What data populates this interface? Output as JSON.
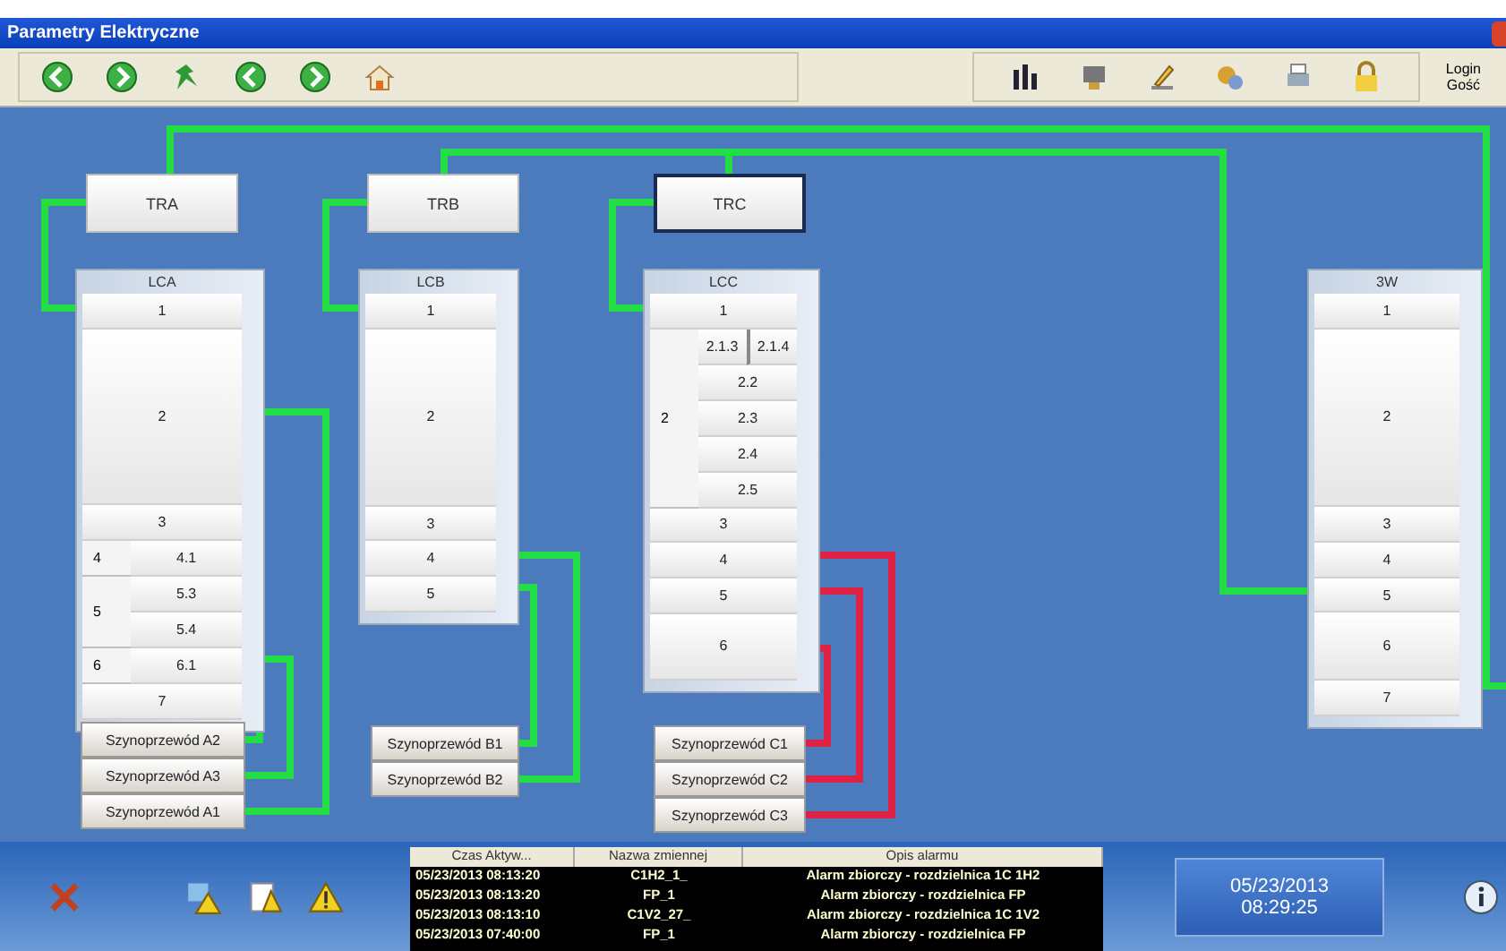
{
  "window": {
    "title": "Parametry Elektryczne"
  },
  "toolbar": {
    "user_label": "Login",
    "user_name": "Gość"
  },
  "transformers": [
    {
      "label": "TRA",
      "selected": false
    },
    {
      "label": "TRB",
      "selected": false
    },
    {
      "label": "TRC",
      "selected": true
    }
  ],
  "panels": [
    {
      "title": "LCA",
      "rows": [
        {
          "kind": "row",
          "label": "1"
        },
        {
          "kind": "tall",
          "label": "2"
        },
        {
          "kind": "row",
          "label": "3"
        },
        {
          "kind": "group",
          "label": "4",
          "children": [
            {
              "kind": "row",
              "label": "4.1"
            }
          ]
        },
        {
          "kind": "group",
          "label": "5",
          "children": [
            {
              "kind": "row",
              "label": "5.3"
            },
            {
              "kind": "row",
              "label": "5.4"
            }
          ]
        },
        {
          "kind": "group",
          "label": "6",
          "children": [
            {
              "kind": "row",
              "label": "6.1"
            }
          ]
        },
        {
          "kind": "row",
          "label": "7"
        }
      ],
      "busbars": [
        {
          "label": "Szynoprzewód A2",
          "color": "#22dd44"
        },
        {
          "label": "Szynoprzewód A3",
          "color": "#22dd44"
        },
        {
          "label": "Szynoprzewód A1",
          "color": "#22dd44"
        }
      ]
    },
    {
      "title": "LCB",
      "rows": [
        {
          "kind": "row",
          "label": "1"
        },
        {
          "kind": "tall",
          "label": "2"
        },
        {
          "kind": "row",
          "label": "3"
        },
        {
          "kind": "row",
          "label": "4"
        },
        {
          "kind": "row",
          "label": "5"
        }
      ],
      "busbars": [
        {
          "label": "Szynoprzewód B1",
          "color": "#22dd44"
        },
        {
          "label": "Szynoprzewód B2",
          "color": "#22dd44"
        }
      ]
    },
    {
      "title": "LCC",
      "rows": [
        {
          "kind": "row",
          "label": "1"
        },
        {
          "kind": "group",
          "label": "2",
          "children": [
            {
              "kind": "split",
              "labels": [
                "2.1.3",
                "2.1.4"
              ]
            },
            {
              "kind": "row",
              "label": "2.2"
            },
            {
              "kind": "row",
              "label": "2.3"
            },
            {
              "kind": "row",
              "label": "2.4"
            },
            {
              "kind": "row",
              "label": "2.5"
            }
          ]
        },
        {
          "kind": "row",
          "label": "3"
        },
        {
          "kind": "row",
          "label": "4"
        },
        {
          "kind": "row",
          "label": "5"
        },
        {
          "kind": "double",
          "label": "6"
        }
      ],
      "busbars": [
        {
          "label": "Szynoprzewód C1",
          "color": "#dd2244"
        },
        {
          "label": "Szynoprzewód C2",
          "color": "#dd2244"
        },
        {
          "label": "Szynoprzewód C3",
          "color": "#dd2244"
        }
      ]
    },
    {
      "title": "3W",
      "rows": [
        {
          "kind": "row",
          "label": "1"
        },
        {
          "kind": "tall",
          "label": "2"
        },
        {
          "kind": "row",
          "label": "3"
        },
        {
          "kind": "row",
          "label": "4"
        },
        {
          "kind": "row",
          "label": "5"
        },
        {
          "kind": "double",
          "label": "6"
        },
        {
          "kind": "row",
          "label": "7"
        }
      ]
    }
  ],
  "alarms": {
    "columns": [
      "Czas Aktyw...",
      "Nazwa zmiennej",
      "Opis alarmu"
    ],
    "rows": [
      [
        "05/23/2013 08:13:20",
        "C1H2_1_",
        "Alarm zbiorczy - rozdzielnica 1C 1H2"
      ],
      [
        "05/23/2013 08:13:20",
        "FP_1",
        "Alarm zbiorczy - rozdzielnica FP"
      ],
      [
        "05/23/2013 08:13:10",
        "C1V2_27_",
        "Alarm zbiorczy - rozdzielnica 1C 1V2"
      ],
      [
        "05/23/2013 07:40:00",
        "FP_1",
        "Alarm zbiorczy - rozdzielnica FP"
      ]
    ]
  },
  "clock": {
    "date": "05/23/2013",
    "time": "08:29:25"
  }
}
